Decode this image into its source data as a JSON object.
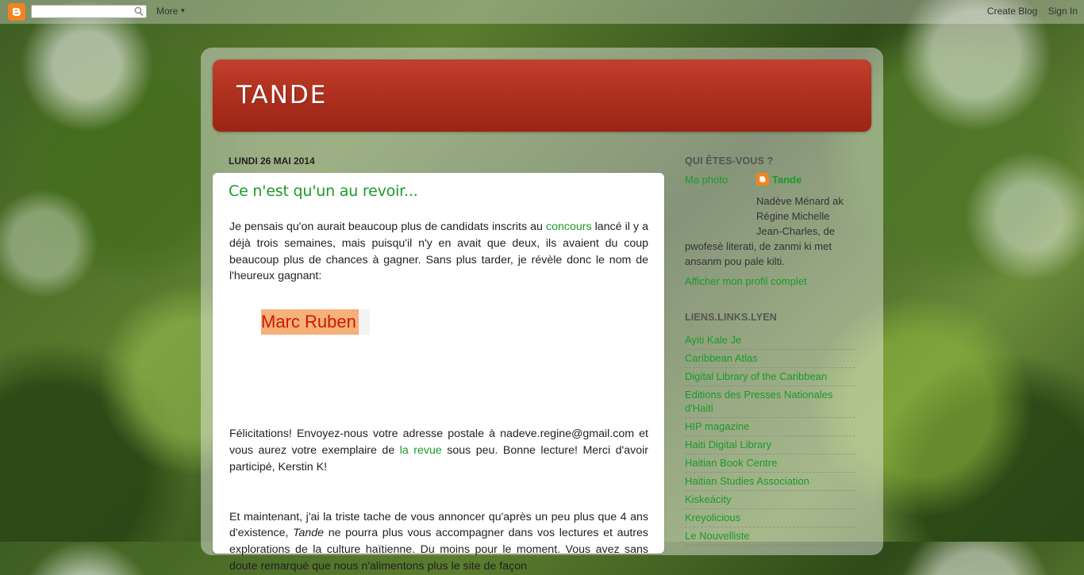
{
  "navbar": {
    "search_placeholder": "",
    "more_label": "More",
    "create_blog": "Create Blog",
    "sign_in": "Sign In"
  },
  "blog": {
    "title": "Tande"
  },
  "post": {
    "date": "LUNDI 26 MAI 2014",
    "title": "Ce n'est qu'un au revoir...",
    "p1_before": "Je pensais qu'on aurait beaucoup plus de candidats inscrits au ",
    "p1_link": "concours",
    "p1_after": " lancé il y a déjà trois semaines, mais puisqu'il n'y en avait que deux, ils avaient du coup beaucoup plus de chances à gagner. Sans plus tarder, je révèle donc le nom de l'heureux gagnant:",
    "winner": "Marc Ruben",
    "p2_before": "Félicitations! Envoyez-nous votre adresse postale à nadeve.regine@gmail.com et vous aurez votre exemplaire de ",
    "p2_link": "la revue",
    "p2_after": " sous peu. Bonne lecture! Merci d'avoir participé, Kerstin K!",
    "p3_before": "Et maintenant, j'ai la triste tache de vous annoncer qu'après un peu plus que 4 ans d'existence, ",
    "p3_em": "Tande",
    "p3_after": " ne pourra plus vous accompagner dans vos lectures et autres explorations de la culture haïtienne. Du moins pour le moment. Vous avez sans doute remarqué que nous n'alimentons plus le site de façon"
  },
  "sidebar": {
    "profile_heading": "QUI ÊTES-VOUS ?",
    "photo_link": "Ma photo",
    "name": "Tande",
    "about_line1": "Nadève Ménard ak",
    "about_line2": "Régine Michelle",
    "about_line3": "Jean-Charles, de",
    "about_rest": "pwofesè literati, de zanmi ki met ansanm pou pale kilti.",
    "full_profile": "Afficher mon profil complet",
    "links_heading": "LIENS.LINKS.LYEN",
    "links": [
      "Ayiti Kale Je",
      "Caribbean Atlas",
      "Digital Library of the Caribbean",
      "Editions des Presses Nationales d'Haiti",
      "HIP magazine",
      "Haiti Digital Library",
      "Haitian Book Centre",
      "Haitian Studies Association",
      "Kiskeácity",
      "Kreyolicious",
      "Le Nouvelliste"
    ]
  }
}
